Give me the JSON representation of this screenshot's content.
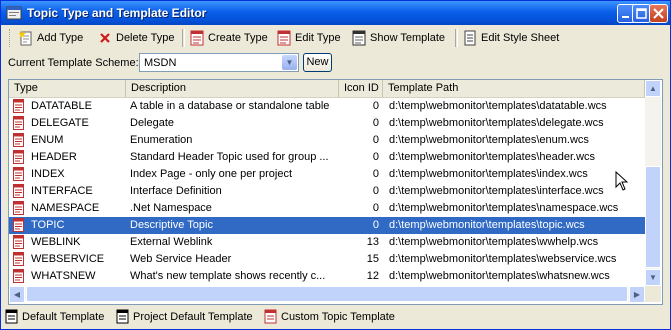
{
  "window": {
    "title": "Topic Type and Template Editor"
  },
  "toolbar": {
    "add_type": "Add Type",
    "delete_type": "Delete Type",
    "create_type": "Create Type",
    "edit_type": "Edit Type",
    "show_template": "Show Template",
    "edit_style_sheet": "Edit Style Sheet"
  },
  "scheme": {
    "label": "Current Template Scheme:",
    "value": "MSDN",
    "new_label": "New"
  },
  "columns": {
    "type": "Type",
    "description": "Description",
    "icon_id": "Icon ID",
    "template_path": "Template Path"
  },
  "rows": [
    {
      "type": "DATATABLE",
      "description": "A table in a database or standalone table",
      "icon_id": "0",
      "path": "d:\\temp\\webmonitor\\templates\\datatable.wcs"
    },
    {
      "type": "DELEGATE",
      "description": "Delegate",
      "icon_id": "0",
      "path": "d:\\temp\\webmonitor\\templates\\delegate.wcs"
    },
    {
      "type": "ENUM",
      "description": "Enumeration",
      "icon_id": "0",
      "path": "d:\\temp\\webmonitor\\templates\\enum.wcs"
    },
    {
      "type": "HEADER",
      "description": "Standard Header Topic used for group ...",
      "icon_id": "0",
      "path": "d:\\temp\\webmonitor\\templates\\header.wcs"
    },
    {
      "type": "INDEX",
      "description": "Index Page - only one per project",
      "icon_id": "0",
      "path": "d:\\temp\\webmonitor\\templates\\index.wcs"
    },
    {
      "type": "INTERFACE",
      "description": "Interface Definition",
      "icon_id": "0",
      "path": "d:\\temp\\webmonitor\\templates\\interface.wcs"
    },
    {
      "type": "NAMESPACE",
      "description": ".Net Namespace",
      "icon_id": "0",
      "path": "d:\\temp\\webmonitor\\templates\\namespace.wcs"
    },
    {
      "type": "TOPIC",
      "description": "Descriptive Topic",
      "icon_id": "0",
      "path": "d:\\temp\\webmonitor\\templates\\topic.wcs"
    },
    {
      "type": "WEBLINK",
      "description": "External Weblink",
      "icon_id": "13",
      "path": "d:\\temp\\webmonitor\\templates\\wwhelp.wcs"
    },
    {
      "type": "WEBSERVICE",
      "description": "Web Service Header",
      "icon_id": "15",
      "path": "d:\\temp\\webmonitor\\templates\\webservice.wcs"
    },
    {
      "type": "WHATSNEW",
      "description": "What's new template shows recently c...",
      "icon_id": "12",
      "path": "d:\\temp\\webmonitor\\templates\\whatsnew.wcs"
    }
  ],
  "selected_row_type": "TOPIC",
  "legend": {
    "default": "Default Template",
    "project_default": "Project Default Template",
    "custom": "Custom Topic Template"
  },
  "colors": {
    "selection": "#316ac5",
    "titlebar": "#0a5fe8",
    "default_icon": "#c03030",
    "project_icon": "#000000"
  }
}
